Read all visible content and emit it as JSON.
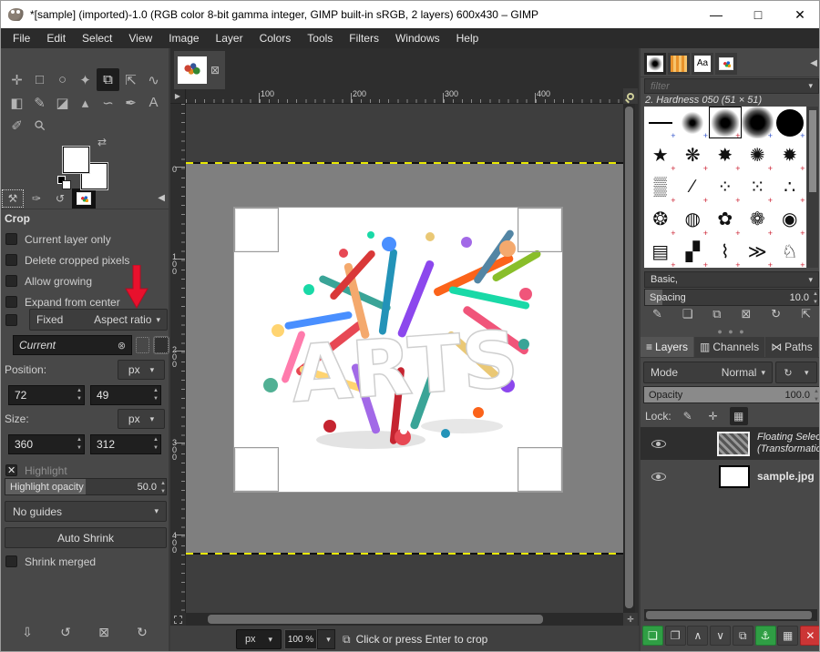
{
  "window": {
    "title": "*[sample] (imported)-1.0 (RGB color 8-bit gamma integer, GIMP built-in sRGB, 2 layers) 600x430 – GIMP",
    "controls": {
      "minimize": "—",
      "maximize": "□",
      "close": "✕"
    }
  },
  "menubar": {
    "items": [
      "File",
      "Edit",
      "Select",
      "View",
      "Image",
      "Layer",
      "Colors",
      "Tools",
      "Filters",
      "Windows",
      "Help"
    ]
  },
  "toolbox": {
    "tools": [
      {
        "name": "move",
        "glyph": "✛"
      },
      {
        "name": "rectangle-select",
        "glyph": "□"
      },
      {
        "name": "free-select",
        "glyph": "○"
      },
      {
        "name": "fuzzy-select",
        "glyph": "✦"
      },
      {
        "name": "crop",
        "glyph": "⧉"
      },
      {
        "name": "unified-transform",
        "glyph": "⇱"
      },
      {
        "name": "warp-transform",
        "glyph": "∿"
      },
      {
        "name": "bucket-fill",
        "glyph": "◧"
      },
      {
        "name": "paintbrush",
        "glyph": "✎"
      },
      {
        "name": "eraser",
        "glyph": "◪"
      },
      {
        "name": "airbrush",
        "glyph": "▴"
      },
      {
        "name": "smudge",
        "glyph": "∽"
      },
      {
        "name": "ink",
        "glyph": "✒"
      },
      {
        "name": "text",
        "glyph": "A"
      },
      {
        "name": "color-picker",
        "glyph": "✐"
      },
      {
        "name": "zoom",
        "glyph": "⚲"
      }
    ],
    "dock_tabs": [
      {
        "name": "tool-options",
        "glyph": "⚒"
      },
      {
        "name": "device-status",
        "glyph": "✑"
      },
      {
        "name": "undo-history",
        "glyph": "↺"
      }
    ],
    "collapse": "◀"
  },
  "tool_options": {
    "title": "Crop",
    "checkboxes": [
      {
        "label": "Current layer only",
        "checked": false
      },
      {
        "label": "Delete cropped pixels",
        "checked": false
      },
      {
        "label": "Allow growing",
        "checked": false
      },
      {
        "label": "Expand from center",
        "checked": false
      }
    ],
    "fixed": {
      "label": "Fixed",
      "dropdown": "Aspect ratio",
      "checked": false
    },
    "aspect_value": "Current",
    "position": {
      "label": "Position:",
      "unit": "px",
      "x": "72",
      "y": "49"
    },
    "size": {
      "label": "Size:",
      "unit": "px",
      "w": "360",
      "h": "312"
    },
    "highlight": {
      "label": "Highlight",
      "checked": true,
      "opacity_label": "Highlight opacity",
      "opacity_value": "50.0"
    },
    "guides": "No guides",
    "auto_shrink": "Auto Shrink",
    "shrink_merged": "Shrink merged",
    "bottom_icons": [
      {
        "name": "save-preset",
        "glyph": "⇩"
      },
      {
        "name": "restore-preset",
        "glyph": "↺"
      },
      {
        "name": "delete-preset",
        "glyph": "⊠"
      },
      {
        "name": "reset-defaults",
        "glyph": "↻"
      }
    ]
  },
  "canvas": {
    "ruler_h": [
      "100",
      "200",
      "300",
      "400"
    ],
    "ruler_v": [
      "0",
      "100",
      "200",
      "300",
      "400"
    ],
    "tab_close": "⊠",
    "corner_btn": "▶",
    "nav_btn": "✛",
    "artwork_text": "ARTS"
  },
  "statusbar": {
    "unit": "px",
    "zoom": "100 %",
    "crop_icon": "⧉",
    "message": "Click or press Enter to crop"
  },
  "right_panel": {
    "filter_placeholder": "filter",
    "brush_label": "2. Hardness 050 (51 × 51)",
    "brush_group": "Basic,",
    "spacing": {
      "label": "Spacing",
      "value": "10.0"
    },
    "brush_actions": [
      {
        "name": "edit-brush",
        "glyph": "✎"
      },
      {
        "name": "new-brush",
        "glyph": "❏"
      },
      {
        "name": "duplicate-brush",
        "glyph": "⧉"
      },
      {
        "name": "delete-brush",
        "glyph": "⊠"
      },
      {
        "name": "refresh-brushes",
        "glyph": "↻"
      },
      {
        "name": "open-brush-as-image",
        "glyph": "⇱"
      }
    ],
    "tabs": [
      {
        "label": "Layers",
        "icon": "≡"
      },
      {
        "label": "Channels",
        "icon": "▥"
      },
      {
        "label": "Paths",
        "icon": "⋈"
      }
    ],
    "mode": {
      "label": "Mode",
      "value": "Normal"
    },
    "opacity": {
      "label": "Opacity",
      "value": "100.0"
    },
    "lock_label": "Lock:",
    "layers": [
      {
        "name": "Floating Selection",
        "sub": "(Transformation)"
      },
      {
        "name": "sample.jpg",
        "sub": ""
      }
    ],
    "layer_buttons": [
      {
        "name": "new-layer",
        "glyph": "❏"
      },
      {
        "name": "new-group",
        "glyph": "❐"
      },
      {
        "name": "raise-layer",
        "glyph": "∧"
      },
      {
        "name": "lower-layer",
        "glyph": "∨"
      },
      {
        "name": "duplicate-layer",
        "glyph": "⧉"
      },
      {
        "name": "anchor-layer",
        "glyph": "⚓"
      },
      {
        "name": "merge-layer",
        "glyph": "▦"
      },
      {
        "name": "delete-layer",
        "glyph": "✕"
      }
    ],
    "collapse": "◀"
  },
  "colors": {
    "annotation_arrow": "#e8112d",
    "accent_green": "#2f9e44",
    "danger_red": "#cc3535",
    "canvas_gray": "#7f7f7f",
    "dashed_boundary_yellow": "#e8e800"
  }
}
